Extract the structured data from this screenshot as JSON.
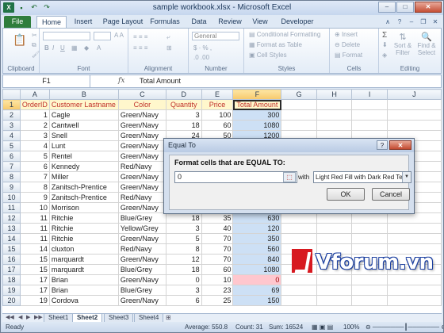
{
  "window": {
    "title": "sample workbook.xlsx - Microsoft Excel",
    "min": "–",
    "max": "□",
    "close": "✕"
  },
  "qat": {
    "icon": "excel-icon",
    "letter": "X"
  },
  "tabs": [
    "File",
    "Home",
    "Insert",
    "Page Layout",
    "Formulas",
    "Data",
    "Review",
    "View",
    "Developer"
  ],
  "ribbon": {
    "groups": {
      "clipboard": "Clipboard",
      "font": "Font",
      "alignment": "Alignment",
      "number": "Number",
      "styles": "Styles",
      "cells": "Cells",
      "editing": "Editing"
    },
    "number_format": "General",
    "styles": {
      "cf": "Conditional Formatting",
      "fat": "Format as Table",
      "cs": "Cell Styles"
    },
    "cells": {
      "insert": "Insert",
      "delete": "Delete",
      "format": "Format"
    },
    "editing": {
      "sort": "Sort &",
      "filter": "Filter",
      "find": "Find &",
      "select": "Select"
    }
  },
  "formula_bar": {
    "namebox": "F1",
    "fx": "fx",
    "content": "Total Amount"
  },
  "columns": [
    "A",
    "B",
    "C",
    "D",
    "E",
    "F",
    "G",
    "H",
    "I",
    "J"
  ],
  "headers": [
    "OrderID",
    "Customer Lastname",
    "Color",
    "Quantity",
    "Price",
    "Total Amount"
  ],
  "rows": [
    {
      "n": "2",
      "id": "1",
      "name": "Cagle",
      "color": "Green/Navy",
      "qty": "3",
      "price": "100",
      "total": "300"
    },
    {
      "n": "3",
      "id": "2",
      "name": "Cantwell",
      "color": "Green/Navy",
      "qty": "18",
      "price": "60",
      "total": "1080"
    },
    {
      "n": "4",
      "id": "3",
      "name": "Snell",
      "color": "Green/Navy",
      "qty": "24",
      "price": "50",
      "total": "1200"
    },
    {
      "n": "5",
      "id": "4",
      "name": "Lunt",
      "color": "Green/Navy",
      "qty": "",
      "price": "",
      "total": ""
    },
    {
      "n": "6",
      "id": "5",
      "name": "Rentel",
      "color": "Green/Navy",
      "qty": "",
      "price": "",
      "total": ""
    },
    {
      "n": "7",
      "id": "6",
      "name": "Kennedy",
      "color": "Red/Navy",
      "qty": "",
      "price": "",
      "total": ""
    },
    {
      "n": "8",
      "id": "7",
      "name": "Miller",
      "color": "Green/Navy",
      "qty": "",
      "price": "",
      "total": ""
    },
    {
      "n": "9",
      "id": "8",
      "name": "Zanitsch-Prentice",
      "color": "Green/Navy",
      "qty": "",
      "price": "",
      "total": ""
    },
    {
      "n": "10",
      "id": "9",
      "name": "Zanitsch-Prentice",
      "color": "Red/Navy",
      "qty": "",
      "price": "",
      "total": ""
    },
    {
      "n": "11",
      "id": "10",
      "name": "Morrison",
      "color": "Green/Navy",
      "qty": "",
      "price": "",
      "total": ""
    },
    {
      "n": "12",
      "id": "11",
      "name": "Ritchie",
      "color": "Blue/Grey",
      "qty": "18",
      "price": "35",
      "total": "630"
    },
    {
      "n": "13",
      "id": "11",
      "name": "Ritchie",
      "color": "Yellow/Grey",
      "qty": "3",
      "price": "40",
      "total": "120"
    },
    {
      "n": "14",
      "id": "11",
      "name": "Ritchie",
      "color": "Green/Navy",
      "qty": "5",
      "price": "70",
      "total": "350"
    },
    {
      "n": "15",
      "id": "14",
      "name": "cluxton",
      "color": "Red/Navy",
      "qty": "8",
      "price": "70",
      "total": "560"
    },
    {
      "n": "16",
      "id": "15",
      "name": "marquardt",
      "color": "Green/Navy",
      "qty": "12",
      "price": "70",
      "total": "840"
    },
    {
      "n": "17",
      "id": "15",
      "name": "marquardt",
      "color": "Blue/Grey",
      "qty": "18",
      "price": "60",
      "total": "1080"
    },
    {
      "n": "18",
      "id": "17",
      "name": "Brian",
      "color": "Green/Navy",
      "qty": "0",
      "price": "10",
      "total": "0"
    },
    {
      "n": "19",
      "id": "17",
      "name": "Brian",
      "color": "Blue/Grey",
      "qty": "3",
      "price": "23",
      "total": "69"
    },
    {
      "n": "20",
      "id": "19",
      "name": "Cordova",
      "color": "Green/Navy",
      "qty": "6",
      "price": "25",
      "total": "150"
    }
  ],
  "sheets": [
    "Sheet1",
    "Sheet2",
    "Sheet3",
    "Sheet4"
  ],
  "status": {
    "ready": "Ready",
    "average": "Average: 550.8",
    "count": "Count: 31",
    "sum": "Sum: 16524",
    "zoom": "100%"
  },
  "dialog": {
    "title": "Equal To",
    "help": "?",
    "close": "✕",
    "prompt": "Format cells that are EQUAL TO:",
    "value": "0",
    "with": "with",
    "format": "Light Red Fill with Dark Red Text",
    "ok": "OK",
    "cancel": "Cancel"
  },
  "watermark": "Vforum.vn",
  "colors": {
    "header_text": "#c0302a",
    "selected_col": "#cde0f5",
    "red_fill": "#ffc7ce",
    "dark_red_text": "#9c0006"
  }
}
